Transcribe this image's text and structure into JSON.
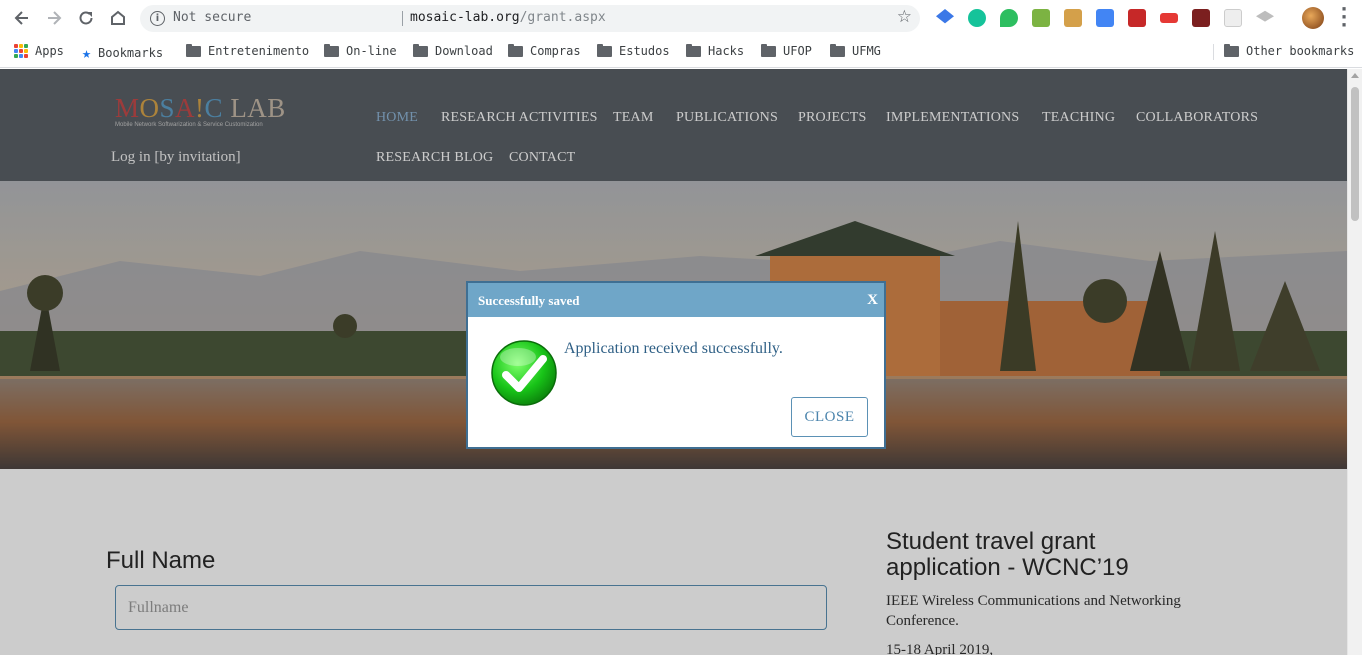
{
  "browser": {
    "security_label": "Not secure",
    "url_domain": "mosaic-lab.org",
    "url_path": "/grant.aspx",
    "bookmarks": {
      "apps": "Apps",
      "bookmarks": "Bookmarks",
      "folders": [
        "Entretenimento",
        "On-line",
        "Download",
        "Compras",
        "Estudos",
        "Hacks",
        "UFOP",
        "UFMG"
      ],
      "other": "Other bookmarks"
    }
  },
  "site": {
    "logo": {
      "m": "M",
      "o": "O",
      "s": "S",
      "a": "A",
      "bang": "!",
      "c": "C",
      "lab": " LAB",
      "tagline": "Mobile Network Softwarization & Service Customization"
    },
    "login": "Log in [by invitation]",
    "nav": [
      "HOME",
      "RESEARCH ACTIVITIES",
      "TEAM",
      "PUBLICATIONS",
      "PROJECTS",
      "IMPLEMENTATIONS",
      "TEACHING",
      "COLLABORATORS",
      "RESEARCH BLOG",
      "CONTACT"
    ],
    "active_nav": "HOME"
  },
  "form": {
    "fullname_label": "Full Name",
    "fullname_placeholder": "Fullname",
    "fullname_value": ""
  },
  "grant": {
    "title": "Student travel grant application - WCNC’19",
    "description": "IEEE Wireless Communications and Networking Conference.",
    "date": "15-18 April 2019,"
  },
  "modal": {
    "title": "Successfully saved",
    "close_x": "X",
    "message": "Application received successfully.",
    "close_button": "CLOSE"
  },
  "colors": {
    "header_bg": "#5b6167",
    "accent": "#6fa6c8",
    "active_nav": "#8fb6d8",
    "success_green": "#2fc42f"
  },
  "icons": [
    "back-icon",
    "forward-icon",
    "reload-icon",
    "home-icon",
    "info-icon",
    "star-icon",
    "apps-grid-icon",
    "bookmark-star-icon",
    "folder-icon",
    "checkmark-icon",
    "kebab-menu-icon"
  ]
}
